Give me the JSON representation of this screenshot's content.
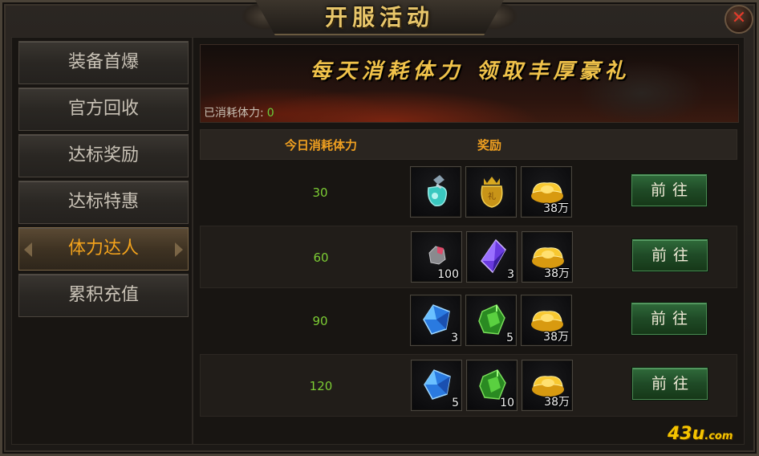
{
  "window": {
    "title": "开服活动",
    "close_glyph": "✕"
  },
  "sidebar": {
    "items": [
      {
        "label": "装备首爆",
        "active": false
      },
      {
        "label": "官方回收",
        "active": false
      },
      {
        "label": "达标奖励",
        "active": false
      },
      {
        "label": "达标特惠",
        "active": false
      },
      {
        "label": "体力达人",
        "active": true
      },
      {
        "label": "累积充值",
        "active": false
      }
    ]
  },
  "banner": {
    "title": "每天消耗体力  领取丰厚豪礼",
    "counter_label": "已消耗体力:",
    "counter_value": "0"
  },
  "table": {
    "headers": {
      "stamina": "今日消耗体力",
      "reward": "奖励"
    },
    "rows": [
      {
        "stamina": "30",
        "button": "前往",
        "rewards": [
          {
            "icon": "potion-bottle-icon",
            "count": ""
          },
          {
            "icon": "gold-sack-icon",
            "count": ""
          },
          {
            "icon": "gold-ingot-icon",
            "count": "38万"
          }
        ]
      },
      {
        "stamina": "60",
        "button": "前往",
        "rewards": [
          {
            "icon": "ore-stone-icon",
            "count": "100"
          },
          {
            "icon": "purple-crystal-icon",
            "count": "3"
          },
          {
            "icon": "gold-ingot-icon",
            "count": "38万"
          }
        ]
      },
      {
        "stamina": "90",
        "button": "前往",
        "rewards": [
          {
            "icon": "blue-crystal-icon",
            "count": "3"
          },
          {
            "icon": "green-gem-icon",
            "count": "5"
          },
          {
            "icon": "gold-ingot-icon",
            "count": "38万"
          }
        ]
      },
      {
        "stamina": "120",
        "button": "前往",
        "rewards": [
          {
            "icon": "blue-crystal-icon",
            "count": "5"
          },
          {
            "icon": "green-gem-icon",
            "count": "10"
          },
          {
            "icon": "gold-ingot-icon",
            "count": "38万"
          }
        ]
      }
    ]
  },
  "watermark": {
    "text": "43u",
    "suffix": ".com"
  },
  "colors": {
    "accent": "#f2a21c",
    "value_green": "#7ccc34",
    "button_green": "#2f6a3a",
    "title_gold": "#e8c66a"
  }
}
